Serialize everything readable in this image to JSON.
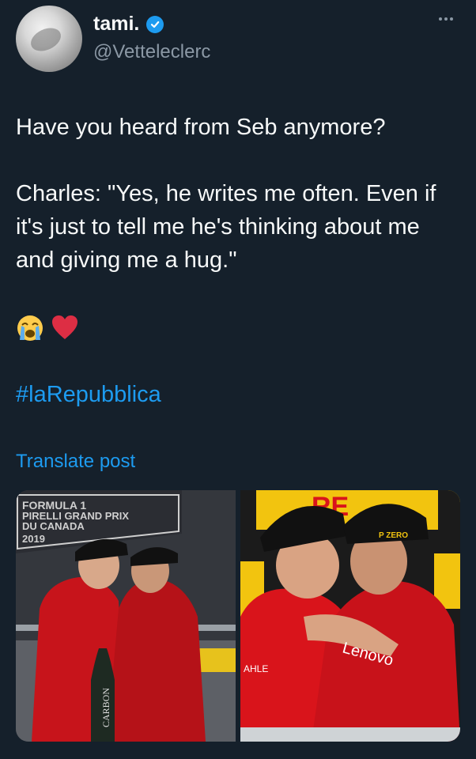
{
  "author": {
    "name": "tami.",
    "handle": "@Vetteleclerc",
    "verified": true
  },
  "tweet": {
    "line1": "Have you heard from Seb anymore?",
    "line2": "Charles: \"Yes, he writes me often. Even if it's just to tell me he's thinking about me and giving me a hug.\"",
    "emojis": [
      "loudly-crying-face",
      "red-heart"
    ],
    "hashtag": "#laRepubblica",
    "translate_label": "Translate post"
  },
  "media": {
    "left_photo": {
      "banner_text": [
        "FORMULA 1",
        "PIRELLI GRAND PRIX",
        "DU CANADA",
        "2019"
      ],
      "bottle_text": "CARBON"
    },
    "right_photo": {
      "sign_text": "RE",
      "sponsor_text": "Lenovo",
      "cap_text": "P ZERO",
      "sleeve_text": "AHLE"
    }
  },
  "colors": {
    "background": "#15202b",
    "accent": "#1d9bf0",
    "secondary_text": "#8b98a5",
    "ferrari_red": "#d9141b"
  }
}
